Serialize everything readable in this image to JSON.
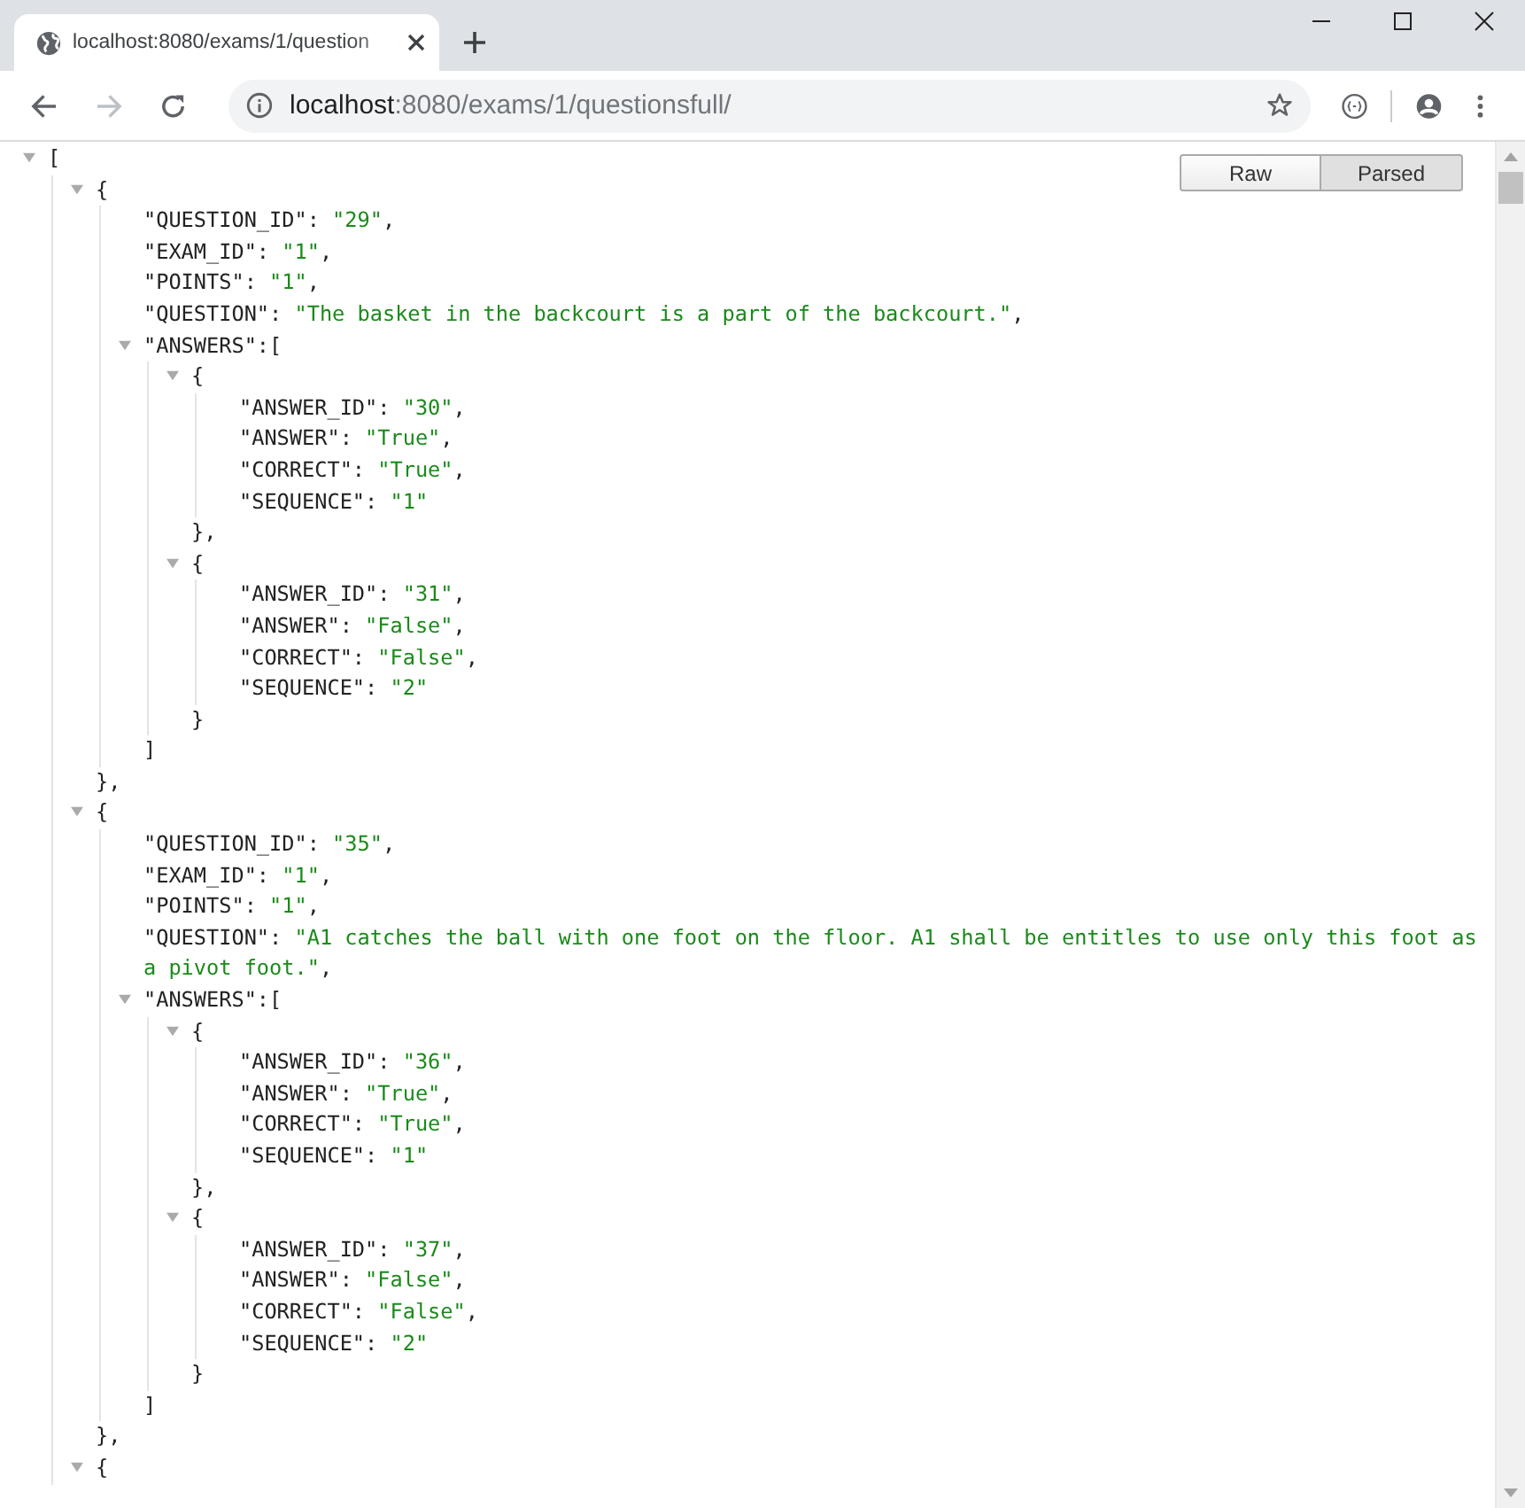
{
  "tab": {
    "title": "localhost:8080/exams/1/question"
  },
  "address": {
    "host": "localhost",
    "path": ":8080/exams/1/questionsfull/"
  },
  "nav": {
    "back_disabled": false,
    "forward_disabled": true
  },
  "view_buttons": [
    {
      "label": "Raw",
      "selected": false
    },
    {
      "label": "Parsed",
      "selected": true
    }
  ],
  "tree": {
    "kind": "container",
    "open": "[",
    "expanded": true,
    "children": [
      {
        "kind": "container",
        "open": "{",
        "expanded": true,
        "close": "},",
        "children": [
          {
            "kind": "field",
            "key": "\"QUESTION_ID\":",
            "value": "\"29\"",
            "end": ","
          },
          {
            "kind": "field",
            "key": "\"EXAM_ID\":",
            "value": "\"1\"",
            "end": ","
          },
          {
            "kind": "field",
            "key": "\"POINTS\":",
            "value": "\"1\"",
            "end": ","
          },
          {
            "kind": "field",
            "key": "\"QUESTION\":",
            "value": "\"The basket in the backcourt is a part of the backcourt.\"",
            "end": ","
          },
          {
            "kind": "container",
            "key": "\"ANSWERS\":",
            "open": "[",
            "expanded": true,
            "close": "]",
            "children": [
              {
                "kind": "container",
                "open": "{",
                "expanded": true,
                "close": "},",
                "children": [
                  {
                    "kind": "field",
                    "key": "\"ANSWER_ID\":",
                    "value": "\"30\"",
                    "end": ","
                  },
                  {
                    "kind": "field",
                    "key": "\"ANSWER\":",
                    "value": "\"True\"",
                    "end": ","
                  },
                  {
                    "kind": "field",
                    "key": "\"CORRECT\":",
                    "value": "\"True\"",
                    "end": ","
                  },
                  {
                    "kind": "field",
                    "key": "\"SEQUENCE\":",
                    "value": "\"1\""
                  }
                ]
              },
              {
                "kind": "container",
                "open": "{",
                "expanded": true,
                "close": "}",
                "children": [
                  {
                    "kind": "field",
                    "key": "\"ANSWER_ID\":",
                    "value": "\"31\"",
                    "end": ","
                  },
                  {
                    "kind": "field",
                    "key": "\"ANSWER\":",
                    "value": "\"False\"",
                    "end": ","
                  },
                  {
                    "kind": "field",
                    "key": "\"CORRECT\":",
                    "value": "\"False\"",
                    "end": ","
                  },
                  {
                    "kind": "field",
                    "key": "\"SEQUENCE\":",
                    "value": "\"2\""
                  }
                ]
              }
            ]
          }
        ]
      },
      {
        "kind": "container",
        "open": "{",
        "expanded": true,
        "close": "},",
        "children": [
          {
            "kind": "field",
            "key": "\"QUESTION_ID\":",
            "value": "\"35\"",
            "end": ","
          },
          {
            "kind": "field",
            "key": "\"EXAM_ID\":",
            "value": "\"1\"",
            "end": ","
          },
          {
            "kind": "field",
            "key": "\"POINTS\":",
            "value": "\"1\"",
            "end": ","
          },
          {
            "kind": "field",
            "key": "\"QUESTION\":",
            "value": "\"A1 catches the ball with one foot on the floor. A1 shall be entitles to use only this foot as a pivot foot.\"",
            "end": ","
          },
          {
            "kind": "container",
            "key": "\"ANSWERS\":",
            "open": "[",
            "expanded": true,
            "close": "]",
            "children": [
              {
                "kind": "container",
                "open": "{",
                "expanded": true,
                "close": "},",
                "children": [
                  {
                    "kind": "field",
                    "key": "\"ANSWER_ID\":",
                    "value": "\"36\"",
                    "end": ","
                  },
                  {
                    "kind": "field",
                    "key": "\"ANSWER\":",
                    "value": "\"True\"",
                    "end": ","
                  },
                  {
                    "kind": "field",
                    "key": "\"CORRECT\":",
                    "value": "\"True\"",
                    "end": ","
                  },
                  {
                    "kind": "field",
                    "key": "\"SEQUENCE\":",
                    "value": "\"1\""
                  }
                ]
              },
              {
                "kind": "container",
                "open": "{",
                "expanded": true,
                "close": "}",
                "children": [
                  {
                    "kind": "field",
                    "key": "\"ANSWER_ID\":",
                    "value": "\"37\"",
                    "end": ","
                  },
                  {
                    "kind": "field",
                    "key": "\"ANSWER\":",
                    "value": "\"False\"",
                    "end": ","
                  },
                  {
                    "kind": "field",
                    "key": "\"CORRECT\":",
                    "value": "\"False\"",
                    "end": ","
                  },
                  {
                    "kind": "field",
                    "key": "\"SEQUENCE\":",
                    "value": "\"2\""
                  }
                ]
              }
            ]
          }
        ]
      },
      {
        "kind": "container",
        "open": "{",
        "expanded": true
      }
    ]
  }
}
